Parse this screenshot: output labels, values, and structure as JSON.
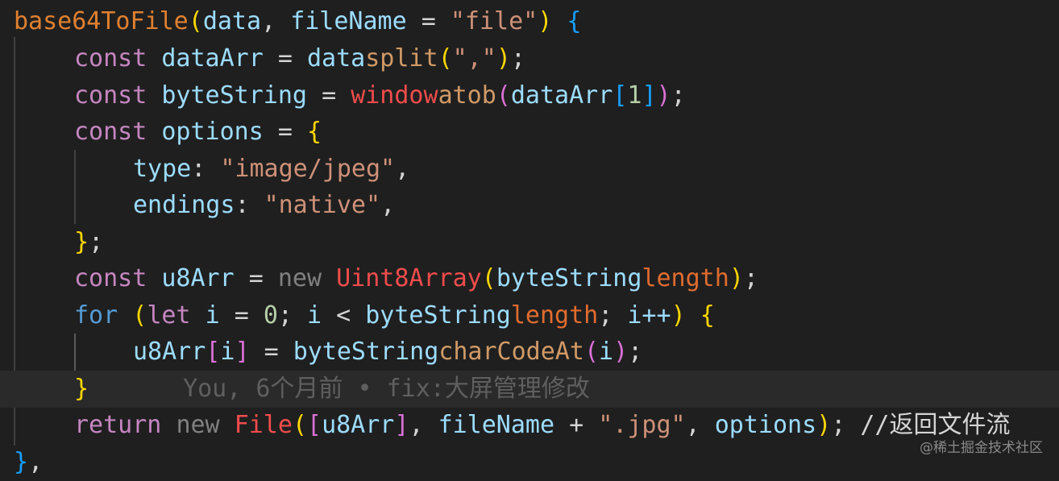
{
  "code": {
    "l1": {
      "name": "base64ToFile",
      "p1": "(",
      "a1": "data",
      ",": ",",
      "a2": "fileName",
      "eq": "=",
      "s": "\"file\"",
      "p2": ")",
      "b": "{"
    },
    "l2": {
      "kw": "const",
      "var": "dataArr",
      "eq": "=",
      "obj": "data",
      ".": ".",
      "m": "split",
      "p1": "(",
      "s": "\",\"",
      "p2": ")",
      "end": ";"
    },
    "l3": {
      "kw": "const",
      "var": "byteString",
      "eq": "=",
      "obj": "window",
      ".": ".",
      "m": "atob",
      "p1": "(",
      "a": "dataArr",
      "i1": "[",
      "n": "1",
      "i2": "]",
      "p2": ")",
      "end": ";"
    },
    "l4": {
      "kw": "const",
      "var": "options",
      "eq": "=",
      "b": "{"
    },
    "l5": {
      "k": "type",
      "c": ":",
      "s": "\"image/jpeg\"",
      ",": ","
    },
    "l6": {
      "k": "endings",
      "c": ":",
      "s": "\"native\"",
      ",": ","
    },
    "l7": {
      "b": "}",
      "end": ";"
    },
    "l8": {
      "kw": "const",
      "var": "u8Arr",
      "eq": "=",
      "nw": "new",
      "cls": "Uint8Array",
      "p1": "(",
      "a": "byteString",
      ".": ".",
      "pr": "length",
      "p2": ")",
      "end": ";"
    },
    "l9": {
      "kw": "for",
      "p1": "(",
      "let": "let",
      "i": "i",
      "eq": "=",
      "z": "0",
      "s1": ";",
      "i2": "i",
      "lt": "<",
      "a": "byteString",
      ".": ".",
      "pr": "length",
      "s2": ";",
      "i3": "i++",
      "p2": ")",
      "b": "{"
    },
    "l10": {
      "a": "u8Arr",
      "i1": "[",
      "i": "i",
      "i2": "]",
      "eq": "=",
      "b": "byteString",
      ".": ".",
      "m": "charCodeAt",
      "p1": "(",
      "arg": "i",
      "p2": ")",
      "end": ";"
    },
    "l11": {
      "b": "}",
      "blame": "You, 6个月前 • fix:大屏管理修改"
    },
    "l12": {
      "kw": "return",
      "nw": "new",
      "cls": "File",
      "p1": "(",
      "br1": "[",
      "a": "u8Arr",
      "br2": "]",
      ",": ",",
      "fn": "fileName",
      "plus": "+",
      "s": "\".jpg\"",
      ",2": ",",
      "opt": "options",
      "p2": ")",
      "end": ";",
      "cmt": "//返回文件流"
    },
    "l13": {
      "b": "}",
      "c": ","
    }
  },
  "watermark": "@稀土掘金技术社区"
}
